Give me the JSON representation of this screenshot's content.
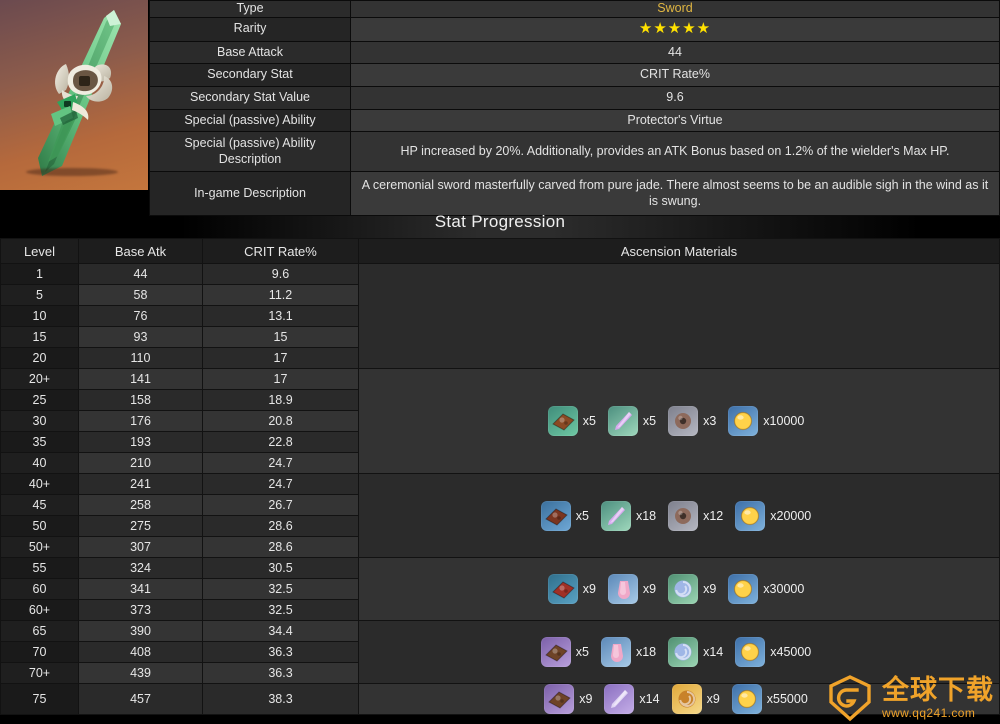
{
  "weapon": {
    "art_alt": "primordial-jade-cutter-sword",
    "rows": [
      {
        "key": "Type",
        "value": "Sword",
        "style": "gold"
      },
      {
        "key": "Rarity",
        "value": "★★★★★",
        "style": "stars",
        "stars": 5
      },
      {
        "key": "Base Attack",
        "value": "44",
        "style": "plain"
      },
      {
        "key": "Secondary Stat",
        "value": "CRIT Rate%",
        "style": "plain"
      },
      {
        "key": "Secondary Stat Value",
        "value": "9.6",
        "style": "plain"
      },
      {
        "key": "Special (passive) Ability",
        "value": "Protector's Virtue",
        "style": "plain"
      },
      {
        "key": "Special (passive) Ability Description",
        "value": "HP increased by 20%. Additionally, provides an ATK Bonus based on 1.2% of the wielder's Max HP.",
        "style": "plain"
      },
      {
        "key": "In-game Description",
        "value": "A ceremonial sword masterfully carved from pure jade. There almost seems to be an audible sigh in the wind as it is swung.",
        "style": "plain"
      }
    ]
  },
  "banner": {
    "title": "Stat Progression"
  },
  "progression": {
    "headers": [
      "Level",
      "Base Atk",
      "CRIT Rate%",
      "Ascension Materials"
    ],
    "rows": [
      {
        "level": "1",
        "atk": "44",
        "crit": "9.6"
      },
      {
        "level": "5",
        "atk": "58",
        "crit": "11.2"
      },
      {
        "level": "10",
        "atk": "76",
        "crit": "13.1"
      },
      {
        "level": "15",
        "atk": "93",
        "crit": "15"
      },
      {
        "level": "20",
        "atk": "110",
        "crit": "17"
      },
      {
        "level": "20+",
        "atk": "141",
        "crit": "17"
      },
      {
        "level": "25",
        "atk": "158",
        "crit": "18.9"
      },
      {
        "level": "30",
        "atk": "176",
        "crit": "20.8"
      },
      {
        "level": "35",
        "atk": "193",
        "crit": "22.8"
      },
      {
        "level": "40",
        "atk": "210",
        "crit": "24.7"
      },
      {
        "level": "40+",
        "atk": "241",
        "crit": "24.7"
      },
      {
        "level": "45",
        "atk": "258",
        "crit": "26.7"
      },
      {
        "level": "50",
        "atk": "275",
        "crit": "28.6"
      },
      {
        "level": "50+",
        "atk": "307",
        "crit": "28.6"
      },
      {
        "level": "55",
        "atk": "324",
        "crit": "30.5"
      },
      {
        "level": "60",
        "atk": "341",
        "crit": "32.5"
      },
      {
        "level": "60+",
        "atk": "373",
        "crit": "32.5"
      },
      {
        "level": "65",
        "atk": "390",
        "crit": "34.4"
      },
      {
        "level": "70",
        "atk": "408",
        "crit": "36.3"
      },
      {
        "level": "70+",
        "atk": "439",
        "crit": "36.3"
      },
      {
        "level": "75",
        "atk": "457",
        "crit": "38.3"
      }
    ],
    "ascension_groups": [
      {
        "span": 5,
        "materials": []
      },
      {
        "span": 5,
        "materials": [
          {
            "icon": "weapon-ascension-tablet-green",
            "qty": "x5"
          },
          {
            "icon": "elite-monster-drop-purple-spine",
            "qty": "x5"
          },
          {
            "icon": "common-drop-brown-nectar",
            "qty": "x3"
          },
          {
            "icon": "mora-coin",
            "qty": "x10000"
          }
        ]
      },
      {
        "span": 4,
        "materials": [
          {
            "icon": "weapon-ascension-tablet-blue",
            "qty": "x5"
          },
          {
            "icon": "elite-monster-drop-purple-spine",
            "qty": "x18"
          },
          {
            "icon": "common-drop-brown-nectar",
            "qty": "x12"
          },
          {
            "icon": "mora-coin",
            "qty": "x20000"
          }
        ]
      },
      {
        "span": 3,
        "materials": [
          {
            "icon": "weapon-ascension-tablet-red",
            "qty": "x9"
          },
          {
            "icon": "elite-monster-drop-pink-sachet",
            "qty": "x9"
          },
          {
            "icon": "common-drop-blue-shell",
            "qty": "x9"
          },
          {
            "icon": "mora-coin",
            "qty": "x30000"
          }
        ]
      },
      {
        "span": 3,
        "materials": [
          {
            "icon": "weapon-ascension-tablet-violet",
            "qty": "x5"
          },
          {
            "icon": "elite-monster-drop-pink-sachet",
            "qty": "x18"
          },
          {
            "icon": "common-drop-blue-shell",
            "qty": "x14"
          },
          {
            "icon": "mora-coin",
            "qty": "x45000"
          }
        ]
      },
      {
        "span": 1,
        "materials": [
          {
            "icon": "weapon-ascension-tablet-violet",
            "qty": "x9"
          },
          {
            "icon": "elite-monster-drop-violet-hook",
            "qty": "x14"
          },
          {
            "icon": "common-drop-gold-shell",
            "qty": "x9"
          },
          {
            "icon": "mora-coin",
            "qty": "x55000"
          }
        ]
      }
    ]
  },
  "watermark": {
    "cn": "全球下载",
    "url": "www.qq241.com",
    "color": "#f0a32a"
  }
}
